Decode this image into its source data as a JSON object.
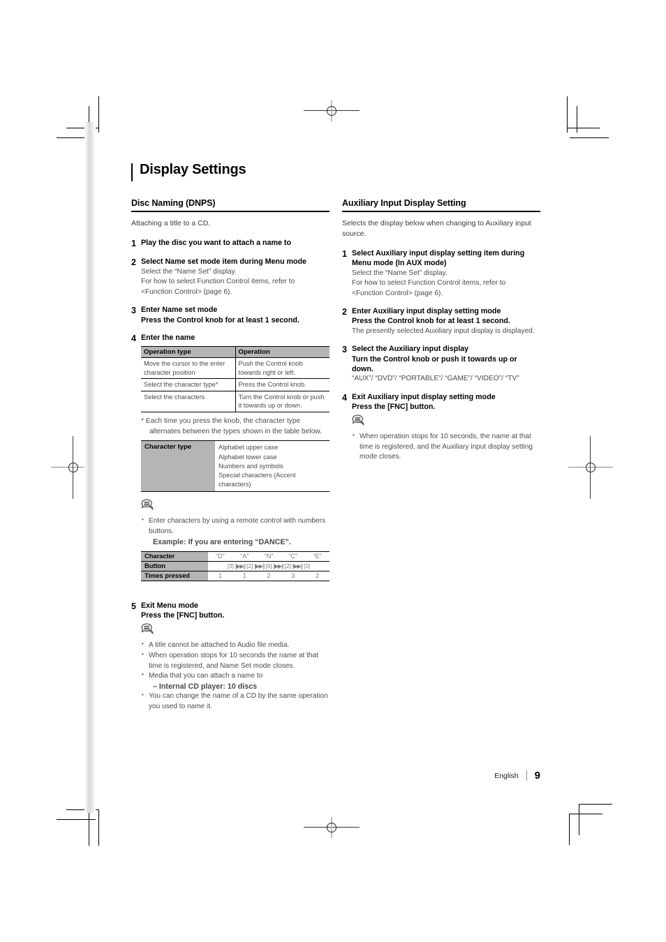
{
  "document": {
    "page_title": "Display Settings",
    "footer": {
      "language": "English",
      "page_number": "9",
      "separator": "|"
    }
  },
  "left_column": {
    "section_title": "Disc Naming (DNPS)",
    "intro": "Attaching a title to a CD.",
    "steps": [
      {
        "num": "1",
        "head": "Play the disc you want to attach a name to"
      },
      {
        "num": "2",
        "head": "Select Name set mode item during Menu mode",
        "desc_lines": [
          "Select the “Name Set” display.",
          "For how to select Function Control items, refer to",
          "<Function Control> (page 6)."
        ]
      },
      {
        "num": "3",
        "head": "Enter Name set mode",
        "sub": "Press the Control knob for at least 1 second."
      },
      {
        "num": "4",
        "head": "Enter the name"
      },
      {
        "num": "5",
        "head": "Exit Menu mode",
        "sub": "Press the [FNC] button."
      }
    ],
    "operation_table": {
      "headers": [
        "Operation type",
        "Operation"
      ],
      "rows": [
        [
          "Move the cursor to the enter character position",
          "Push the Control knob towards right or left."
        ],
        [
          "Select the character type*",
          "Press the Control knob."
        ],
        [
          "Select the characters",
          "Turn the Control knob or push it towards up or down."
        ]
      ]
    },
    "footnote": "* Each time you press the knob, the character type alternates between the types shown in the table below.",
    "character_type_table": {
      "label": "Character type",
      "items": [
        "Alphabet upper case",
        "Alphabet lower case",
        "Numbers and symbols",
        "Special characters (Accent characters)"
      ]
    },
    "note_remote": {
      "icon": "note-bubble-icon",
      "bullets": [
        "Enter characters by using a remote control with numbers buttons.",
        "Example: If you are entering “DANCE”."
      ]
    },
    "dance_table": {
      "row_labels": [
        "Character",
        "Button",
        "Times pressed"
      ],
      "characters": [
        "“D”",
        "“A”",
        "“N”",
        "“C”",
        "“E”"
      ],
      "buttons": [
        "[3]",
        "[▶▶|]",
        "[2]",
        "[▶▶|]",
        "[6]",
        "[▶▶|]",
        "[2]",
        "[▶▶|]",
        "[3]"
      ],
      "button_keys": [
        "[3]",
        "[2]",
        "[6]",
        "[2]",
        "[3]"
      ],
      "button_separator": "▶▶|",
      "times_pressed": [
        "1",
        "1",
        "2",
        "3",
        "2"
      ]
    },
    "note_final": {
      "icon": "note-bubble-icon",
      "bullets": [
        {
          "text": "A title cannot be attached to Audio file media.",
          "sub": false
        },
        {
          "text": "When operation stops for 10 seconds the name at that time is registered, and Name Set mode closes.",
          "sub": false
        },
        {
          "text": "Media that you can attach a name to",
          "sub": false
        },
        {
          "text": "– Internal CD player: 10 discs",
          "sub": true
        },
        {
          "text": "You can change the name of a CD by the same operation you used to name it.",
          "sub": false
        }
      ]
    }
  },
  "right_column": {
    "section_title": "Auxiliary Input Display Setting",
    "intro": "Selects the display below when changing to Auxiliary input source.",
    "steps": [
      {
        "num": "1",
        "head": "Select Auxiliary input display setting item during Menu mode (In AUX mode)",
        "desc_lines": [
          "Select the “Name Set” display.",
          "For how to select Function Control items, refer to",
          "<Function Control> (page 6)."
        ]
      },
      {
        "num": "2",
        "head": "Enter Auxiliary input display setting mode",
        "sub": "Press the Control knob for at least 1 second.",
        "desc_lines": [
          "The presently selected Auxiliary input display is displayed."
        ]
      },
      {
        "num": "3",
        "head": "Select the Auxiliary input display",
        "sub": "Turn the Control knob or push it towards up or down.",
        "desc_lines": [
          "“AUX”/ “DVD”/ “PORTABLE”/ “GAME”/ “VIDEO”/ “TV”"
        ]
      },
      {
        "num": "4",
        "head": "Exit Auxiliary input display setting mode",
        "sub": "Press the [FNC] button."
      }
    ],
    "note": {
      "icon": "note-bubble-icon",
      "bullets": [
        "When operation stops for 10 seconds, the name at that time is registered, and the Auxiliary input display setting mode closes."
      ]
    }
  },
  "colors": {
    "table_header_gray": "#b5b5b5",
    "body_text": "#4a4a4a",
    "heading": "#000000"
  }
}
